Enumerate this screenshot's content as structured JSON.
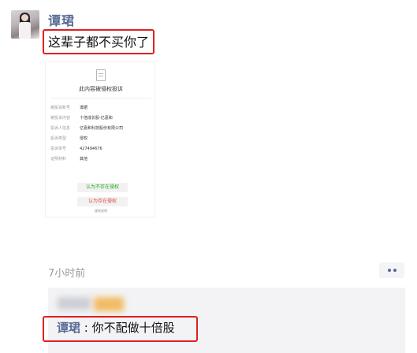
{
  "post": {
    "username": "谭珺",
    "text": "这辈子都不买你了",
    "time": "7小时前"
  },
  "card": {
    "title": "此内容被侵权投诉",
    "rows": [
      {
        "label": "被投诉账号",
        "value": "谭珺"
      },
      {
        "label": "被投诉内容",
        "value": "十倍成长股-亿嘉和"
      },
      {
        "label": "投诉人信息",
        "value": "亿嘉和科技股份有限公司"
      },
      {
        "label": "投诉类型",
        "value": "侵权"
      },
      {
        "label": "投诉单号",
        "value": "427494676"
      },
      {
        "label": "证明材料",
        "value": "其他"
      }
    ],
    "btn_not_infringe": "认为不存在侵权",
    "btn_infringe": "认为存在侵权",
    "rules_link": "规则说明"
  },
  "comment": {
    "author": "谭珺",
    "separator": ":",
    "text": "你不配做十倍股"
  },
  "colors": {
    "name_blue": "#576b95",
    "annotation_red": "#e02020",
    "green": "#1aad19",
    "red": "#e64340"
  }
}
